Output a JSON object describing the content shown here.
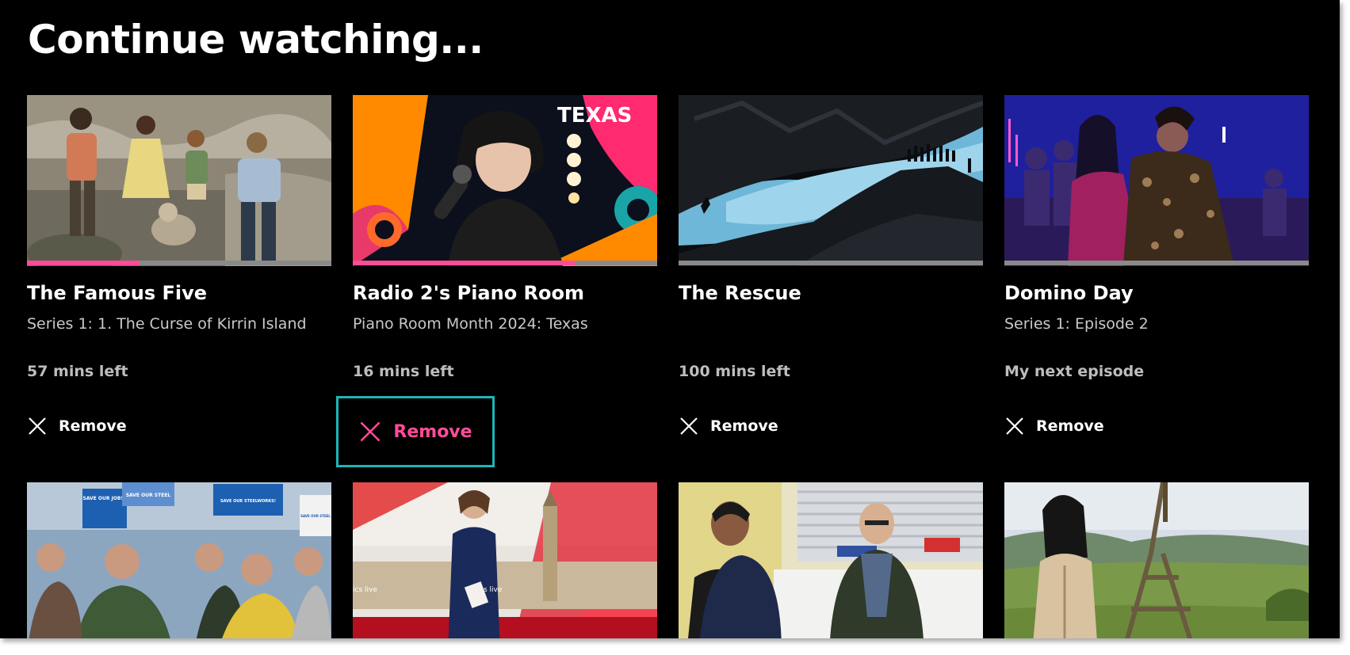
{
  "page": {
    "heading": "Continue watching..."
  },
  "colors": {
    "background": "#000000",
    "progress_fill": "#ff4c98",
    "progress_track": "#8a8a8a",
    "focus_ring": "#1fb5b8",
    "remove_focused_text": "#ff4c98"
  },
  "cards": [
    {
      "title": "The Famous Five",
      "subtitle": "Series 1: 1. The Curse of Kirrin Island",
      "status": "57 mins left",
      "progress": 0.37,
      "remove_label": "Remove",
      "focused": false
    },
    {
      "title": "Radio 2's Piano Room",
      "subtitle": "Piano Room Month 2024: Texas",
      "status": "16 mins left",
      "progress": 0.73,
      "remove_label": "Remove",
      "focused": true,
      "thumbnail_text": "TEXAS"
    },
    {
      "title": "The Rescue",
      "subtitle": "",
      "status": "100 mins left",
      "progress": 0.0,
      "remove_label": "Remove",
      "focused": false
    },
    {
      "title": "Domino Day",
      "subtitle": "Series 1: Episode 2",
      "status": "My next episode",
      "progress": 0.0,
      "remove_label": "Remove",
      "focused": false
    }
  ],
  "second_row_signs": [
    "SAVE OUR JOBS!",
    "SAVE OUR STEEL",
    "SAVE OUR STEELWORKS!",
    "SAVE OUR STEEL"
  ],
  "second_row_overlays": [
    "ics live",
    "s live"
  ]
}
